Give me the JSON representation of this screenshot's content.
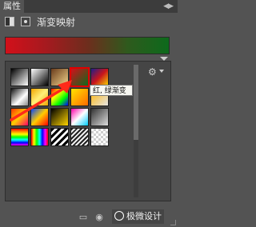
{
  "panel": {
    "tab_label": "属性",
    "title": "渐变映射"
  },
  "current_gradient": {
    "colors": [
      "#d2101a",
      "#0d6a1c"
    ]
  },
  "tooltip": {
    "text": "红, 绿渐变"
  },
  "watermark": {
    "text": "极微设计"
  },
  "swatches": [
    {
      "row": 0,
      "col": 0,
      "bg": "linear-gradient(135deg,#000 0%,#fff 100%)"
    },
    {
      "row": 0,
      "col": 1,
      "bg": "linear-gradient(135deg,#fff 0%,#000 100%)"
    },
    {
      "row": 0,
      "col": 2,
      "bg": "linear-gradient(135deg,#6a3c1c 0%,#f1d38a 100%)"
    },
    {
      "row": 0,
      "col": 3,
      "bg": "linear-gradient(135deg,#d2101a 0%,#0d6a1c 100%)"
    },
    {
      "row": 0,
      "col": 4,
      "bg": "linear-gradient(135deg,#1e1e8a 0%,#c8151c 50%,#f6d400 100%)"
    },
    {
      "row": 1,
      "col": 0,
      "bg": "linear-gradient(135deg,#111 0%,#fff 60%,#888 100%)"
    },
    {
      "row": 1,
      "col": 1,
      "bg": "linear-gradient(135deg,#f0a500 0%,#fff07a 50%,#f0a500 100%)"
    },
    {
      "row": 1,
      "col": 2,
      "bg": "linear-gradient(135deg,#ff0000 0%,#ffff00 33%,#00ff00 66%,#0000ff 100%)"
    },
    {
      "row": 1,
      "col": 3,
      "bg": "linear-gradient(135deg,#ffe400 0%,#ff6a00 100%)"
    },
    {
      "row": 1,
      "col": 4,
      "bg": "linear-gradient(135deg,#ffb400 0%,#e5e5e5 100%)"
    },
    {
      "row": 2,
      "col": 0,
      "bg": "linear-gradient(135deg,#ff3300 0%,#ffcc00 50%,#ff0066 100%)"
    },
    {
      "row": 2,
      "col": 1,
      "bg": "linear-gradient(135deg,#0044ff 0%,#ffcc00 50%,#ff0000 100%)"
    },
    {
      "row": 2,
      "col": 2,
      "bg": "linear-gradient(135deg,#000 0%,#ffd500 100%)"
    },
    {
      "row": 2,
      "col": 3,
      "bg": "linear-gradient(135deg,#ff00aa 0%,#ffffff 50%,#00ccff 100%)"
    },
    {
      "row": 2,
      "col": 4,
      "bg": "linear-gradient(135deg,#333 0%,#ddd 100%)"
    },
    {
      "row": 3,
      "col": 0,
      "bg": "linear-gradient(180deg,#ff0000,#ff8800,#ffff00,#00ff00,#00ffff,#0000ff,#ff00ff)"
    },
    {
      "row": 3,
      "col": 1,
      "bg": "linear-gradient(90deg,#ff0000,#ffff00,#00ff00,#00ffff,#0000ff,#ff00ff,#ff0000)"
    },
    {
      "row": 3,
      "col": 2,
      "bg": "repeating-linear-gradient(135deg,#000 0 3px,#fff 3px 6px)"
    },
    {
      "row": 3,
      "col": 3,
      "bg": "repeating-linear-gradient(135deg,#222 0 2px,#eee 2px 4px)"
    },
    {
      "row": 3,
      "col": 4,
      "bg": "repeating-conic-gradient(#cfcfcf 0 25%,#ffffff 0 50%) 0 0/6px 6px"
    }
  ]
}
